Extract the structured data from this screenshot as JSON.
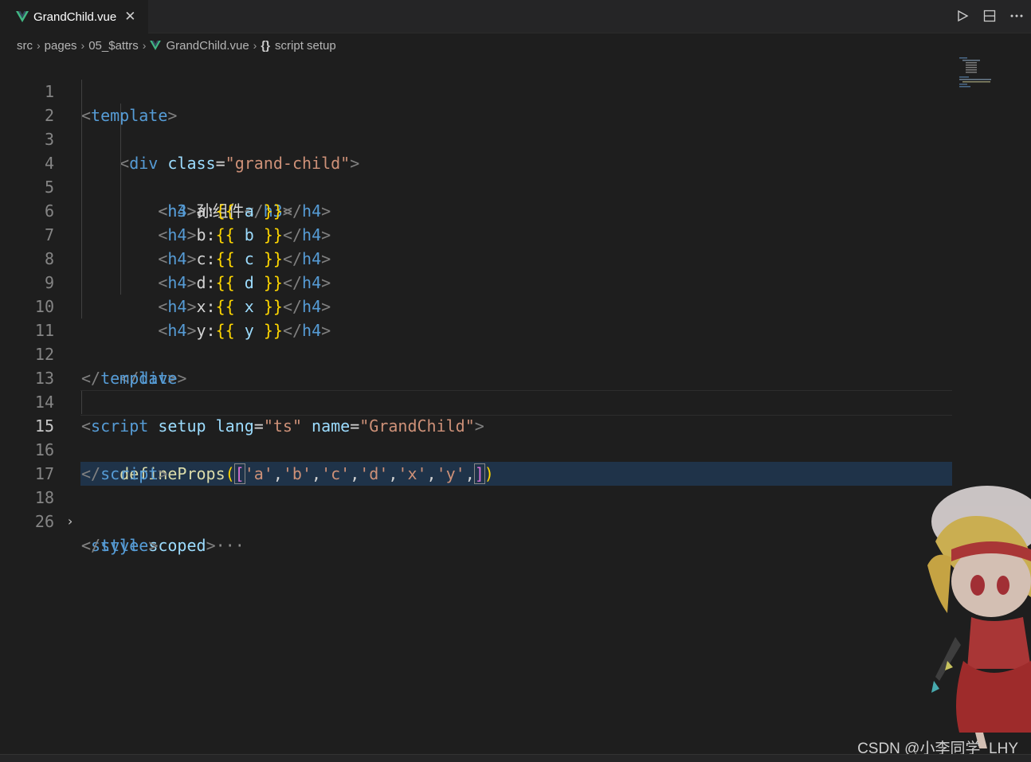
{
  "tab": {
    "title": "GrandChild.vue",
    "close_glyph": "✕"
  },
  "actions": {
    "run_icon": "run-icon",
    "split_icon": "split-editor-icon",
    "more_icon": "more-icon"
  },
  "breadcrumb": {
    "items": [
      "src",
      "pages",
      "05_$attrs",
      "GrandChild.vue",
      "script setup"
    ],
    "braces": "{}"
  },
  "editor": {
    "line_numbers": [
      "1",
      "2",
      "3",
      "4",
      "5",
      "6",
      "7",
      "8",
      "9",
      "10",
      "11",
      "12",
      "13",
      "14",
      "15",
      "16",
      "17",
      "18",
      "26"
    ],
    "current_line": "15",
    "folded_ellipsis": "···",
    "code": {
      "l1": {
        "tag": "template"
      },
      "l2": {
        "tag": "div",
        "attr": "class",
        "value": "\"grand-child\""
      },
      "l3": {
        "tag": "h3",
        "text": "孙组件"
      },
      "props": [
        {
          "label": "a:",
          "var": "a"
        },
        {
          "label": "b:",
          "var": "b"
        },
        {
          "label": "c:",
          "var": "c"
        },
        {
          "label": "d:",
          "var": "d"
        },
        {
          "label": "x:",
          "var": "x"
        },
        {
          "label": "y:",
          "var": "y"
        }
      ],
      "h4_tag": "h4",
      "mustache_open": "{{",
      "mustache_close": "}}",
      "l11": {
        "tag": "div"
      },
      "l12": {
        "tag": "template"
      },
      "l14": {
        "tag": "script",
        "attr1": "setup",
        "attr2": "lang",
        "val2": "\"ts\"",
        "attr3": "name",
        "val3": "\"GrandChild\""
      },
      "l15": {
        "fn": "defineProps",
        "items": [
          "'a'",
          "'b'",
          "'c'",
          "'d'",
          "'x'",
          "'y'"
        ]
      },
      "l16": {
        "tag": "script"
      },
      "l18": {
        "tag": "style",
        "attr": "scoped"
      },
      "l26": {
        "tag": "style"
      }
    }
  },
  "watermark": "CSDN @小李同学_LHY",
  "colors": {
    "tag": "#569cd6",
    "attr": "#9cdcfe",
    "string": "#ce9178",
    "function": "#dcdcaa",
    "bracket": "#ffd700",
    "accent_vue": "#41b883"
  }
}
